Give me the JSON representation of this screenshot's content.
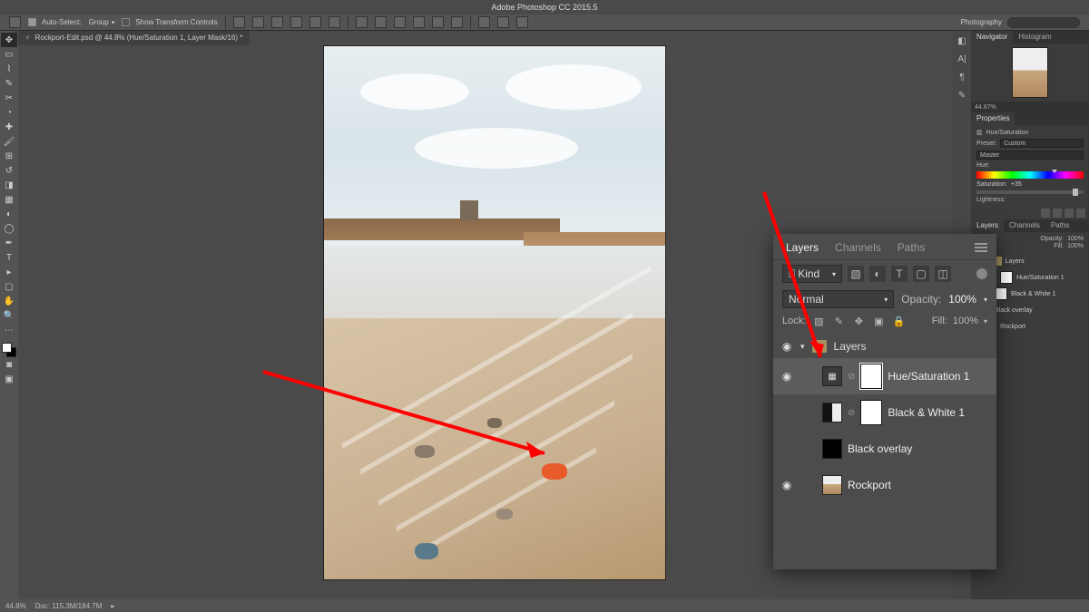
{
  "app_title": "Adobe Photoshop CC 2015.5",
  "workspace": "Photography",
  "options_bar": {
    "auto_select_label": "Auto-Select:",
    "auto_select_mode": "Group",
    "show_transform_label": "Show Transform Controls"
  },
  "document_tab": "Rockport-Edit.psd @ 44.8% (Hue/Saturation 1, Layer Mask/16) *",
  "status": {
    "zoom": "44.8%",
    "info": "Doc: 115.3M/184.7M"
  },
  "navigator": {
    "tabs": [
      "Navigator",
      "Histogram"
    ],
    "zoom": "44.87%"
  },
  "properties": {
    "title": "Properties",
    "adjustment_type": "Hue/Saturation",
    "preset_label": "Preset:",
    "preset_value": "Custom",
    "channel_value": "Master",
    "hue_label": "Hue:",
    "saturation_label": "Saturation:",
    "saturation_value": "+35",
    "lightness_label": "Lightness:"
  },
  "mini_layers": {
    "tabs": [
      "Layers",
      "Channels",
      "Paths"
    ],
    "opacity_label": "Opacity:",
    "opacity_value": "100%",
    "fill_label": "Fill:",
    "fill_value": "100%",
    "group": "Layers",
    "items": [
      "Hue/Saturation 1",
      "Black & White 1",
      "Black overlay",
      "Rockport"
    ]
  },
  "layers_popup": {
    "tabs": [
      "Layers",
      "Channels",
      "Paths"
    ],
    "active_tab": "Layers",
    "filter_kind": "Kind",
    "blend_mode": "Normal",
    "opacity_label": "Opacity:",
    "opacity_value": "100%",
    "lock_label": "Lock:",
    "fill_label": "Fill:",
    "fill_value": "100%",
    "group_name": "Layers",
    "layers": [
      {
        "name": "Hue/Saturation 1",
        "type": "adjust-hsl",
        "visible": true,
        "selected": true,
        "has_mask": true
      },
      {
        "name": "Black & White 1",
        "type": "adjust-bw",
        "visible": false,
        "selected": false,
        "has_mask": true
      },
      {
        "name": "Black overlay",
        "type": "solid-black",
        "visible": false,
        "selected": false,
        "has_mask": false
      },
      {
        "name": "Rockport",
        "type": "image",
        "visible": true,
        "selected": false,
        "has_mask": false
      }
    ]
  },
  "icons": {
    "eye": "◉"
  }
}
